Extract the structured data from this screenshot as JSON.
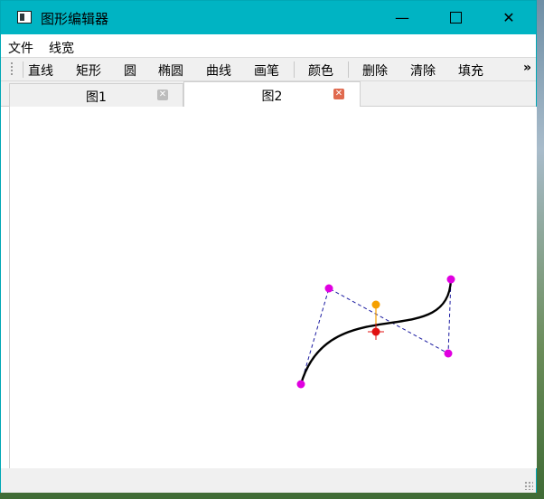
{
  "window": {
    "title": "图形编辑器",
    "minimize": "—",
    "close": "✕"
  },
  "menu": [
    "文件",
    "线宽"
  ],
  "toolbar": {
    "line": "直线",
    "rect": "矩形",
    "circle": "圆",
    "ellipse": "椭圆",
    "curve": "曲线",
    "pen": "画笔",
    "color": "颜色",
    "delete": "删除",
    "clear": "清除",
    "fill": "填充",
    "more": "»"
  },
  "tabs": [
    {
      "label": "图1",
      "close": "✕"
    },
    {
      "label": "图2",
      "close": "✕"
    }
  ],
  "colors": {
    "accent": "#00b4c3",
    "control_point": "#e000e0",
    "center_point": "#f5a000",
    "anchor_point": "#e01010",
    "guide_line": "#1a1aa0",
    "curve": "#000000"
  }
}
